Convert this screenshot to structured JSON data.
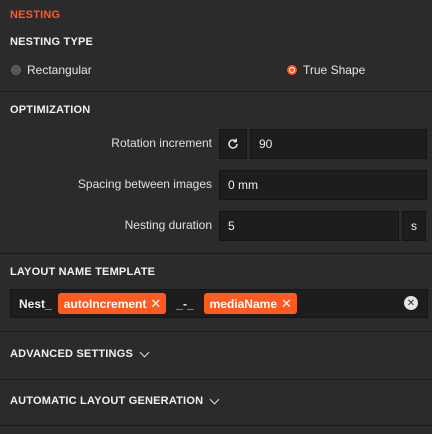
{
  "header": {
    "title": "NESTING"
  },
  "nesting_type": {
    "title": "NESTING TYPE",
    "options": [
      {
        "label": "Rectangular",
        "selected": false
      },
      {
        "label": "True Shape",
        "selected": true
      }
    ]
  },
  "optimization": {
    "title": "OPTIMIZATION",
    "rotation": {
      "label": "Rotation increment",
      "value": "90",
      "icon": "rotate-icon"
    },
    "spacing": {
      "label": "Spacing between images",
      "value": "0 mm"
    },
    "duration": {
      "label": "Nesting duration",
      "value": "5",
      "unit": "s"
    }
  },
  "layout_name": {
    "title": "LAYOUT NAME TEMPLATE",
    "prefix": "Nest_",
    "chip1": "autoIncrement",
    "separator": "_-_",
    "chip2": "mediaName"
  },
  "advanced": {
    "label": "ADVANCED SETTINGS"
  },
  "auto_layout": {
    "label": "AUTOMATIC LAYOUT GENERATION"
  },
  "colors": {
    "accent": "#ff5a1f",
    "header": "#ff5a2a",
    "background": "#2b2b2b",
    "input": "#1d1d1d"
  }
}
